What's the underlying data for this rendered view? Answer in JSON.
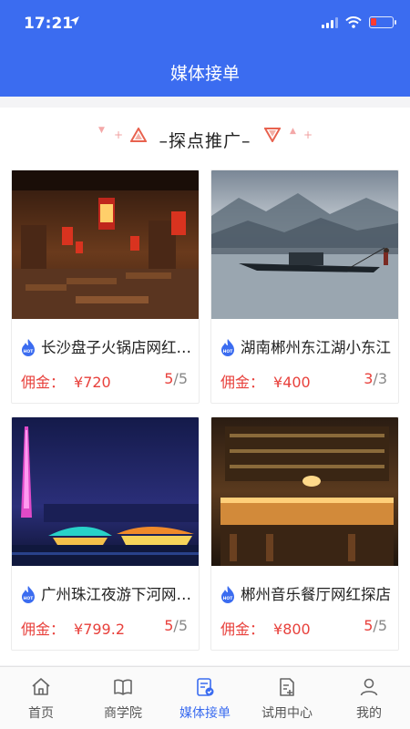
{
  "status_bar": {
    "time": "17:21"
  },
  "nav": {
    "title": "媒体接单"
  },
  "section": {
    "title": "–探点推广–"
  },
  "cards": [
    {
      "title": "长沙盘子火锅店网红探店",
      "commission_label": "佣金：",
      "commission_amount": "¥720",
      "slots_current": "5",
      "slots_total": "/5"
    },
    {
      "title": "湖南郴州东江湖小东江",
      "commission_label": "佣金：",
      "commission_amount": "¥400",
      "slots_current": "3",
      "slots_total": "/3"
    },
    {
      "title": "广州珠江夜游下河网红探点",
      "commission_label": "佣金：",
      "commission_amount": "¥799.2",
      "slots_current": "5",
      "slots_total": "/5"
    },
    {
      "title": "郴州音乐餐厅网红探店",
      "commission_label": "佣金：",
      "commission_amount": "¥800",
      "slots_current": "5",
      "slots_total": "/5"
    }
  ],
  "tabs": [
    {
      "label": "首页",
      "icon": "home-icon"
    },
    {
      "label": "商学院",
      "icon": "book-icon"
    },
    {
      "label": "媒体接单",
      "icon": "order-icon",
      "active": true
    },
    {
      "label": "试用中心",
      "icon": "trial-icon"
    },
    {
      "label": "我的",
      "icon": "user-icon"
    }
  ],
  "colors": {
    "primary": "#3b6cf0",
    "price": "#e8413c",
    "battery_low": "#ff3b30"
  }
}
